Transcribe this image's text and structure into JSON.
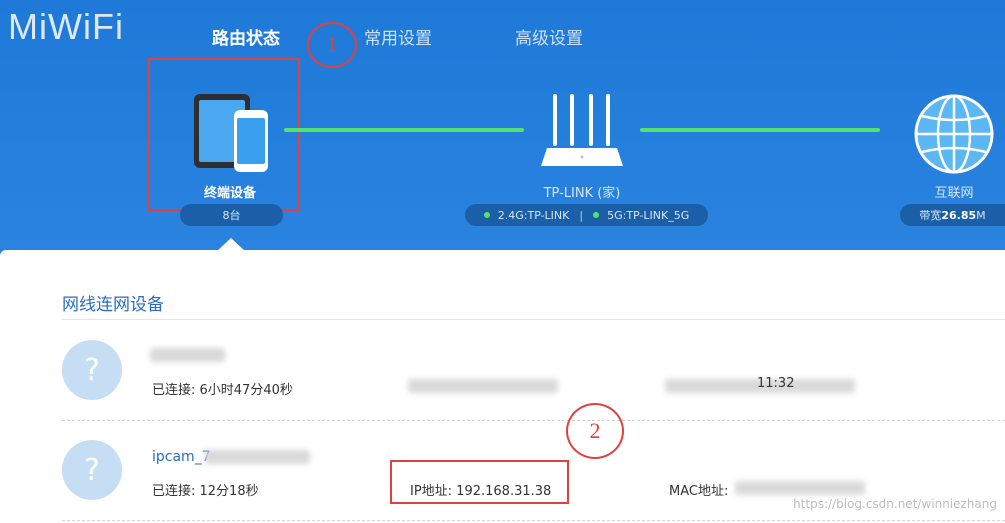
{
  "logo": "MiWiFi",
  "nav": [
    {
      "label": "路由状态"
    },
    {
      "label": "常用设置"
    },
    {
      "label": "高级设置"
    }
  ],
  "annotations": [
    "1",
    "2"
  ],
  "topology": {
    "devices": {
      "label": "终端设备",
      "count": "8台"
    },
    "router": {
      "label": "TP-LINK (家)",
      "band_24": "2.4G:TP-LINK",
      "band_5": "5G:TP-LINK_5G",
      "separator": "|"
    },
    "internet": {
      "label": "互联网",
      "bandwidth_prefix": "带宽",
      "bandwidth_value": "26.85",
      "bandwidth_unit": "M"
    }
  },
  "panel": {
    "title": "网线连网设备",
    "devices": [
      {
        "name": "",
        "connected": "已连接: 6小时47分40秒",
        "ip": "",
        "mac": "11:32"
      },
      {
        "name": "ipcam_7",
        "connected": "已连接: 12分18秒",
        "ip": "IP地址: 192.168.31.38",
        "mac": "MAC地址:"
      }
    ]
  },
  "watermark": "https://blog.csdn.net/winniezhang"
}
